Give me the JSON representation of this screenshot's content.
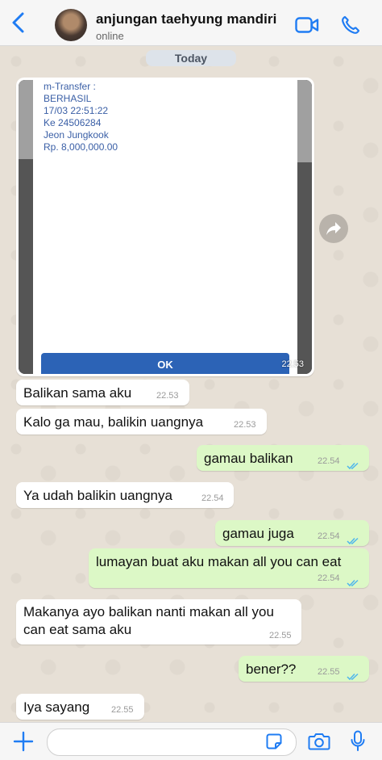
{
  "header": {
    "contact_name": "anjungan taehyung mandiri",
    "status": "online",
    "icons": [
      "back-chevron-icon",
      "video-call-icon",
      "phone-call-icon"
    ],
    "accent_color": "#1f7cf3"
  },
  "date_divider": "Today",
  "image_message": {
    "screenshot_lines": [
      "m-Transfer :",
      "BERHASIL",
      "17/03 22:51:22",
      "Ke 24506284",
      "Jeon Jungkook",
      "Rp. 8,000,000.00"
    ],
    "ok_button": "OK",
    "time": "22.53"
  },
  "messages": [
    {
      "direction": "in",
      "text": "Balikan sama aku",
      "time": "22.53"
    },
    {
      "direction": "in",
      "text": "Kalo ga mau, balikin uangnya",
      "time": "22.53"
    },
    {
      "direction": "out",
      "text": "gamau balikan",
      "time": "22.54",
      "read": true
    },
    {
      "direction": "in",
      "text": "Ya udah balikin uangnya",
      "time": "22.54"
    },
    {
      "direction": "out",
      "text": "gamau juga",
      "time": "22.54",
      "read": true
    },
    {
      "direction": "out",
      "text": "lumayan buat aku makan all you can eat",
      "time": "22.54",
      "read": true
    },
    {
      "direction": "in",
      "text_lines": [
        "Makanya ayo balikan nanti makan all you",
        "can eat sama aku"
      ],
      "time": "22.55"
    },
    {
      "direction": "out",
      "text": "bener??",
      "time": "22.55",
      "read": true
    },
    {
      "direction": "in",
      "text": "Iya sayang",
      "time": "22.55"
    }
  ],
  "input_bar": {
    "message_value": "",
    "icons": [
      "plus-icon",
      "sticker-icon",
      "camera-icon",
      "microphone-icon"
    ]
  },
  "colors": {
    "outgoing_bubble": "#dcf8c6",
    "incoming_bubble": "#ffffff",
    "read_ticks": "#4fb6ec"
  }
}
